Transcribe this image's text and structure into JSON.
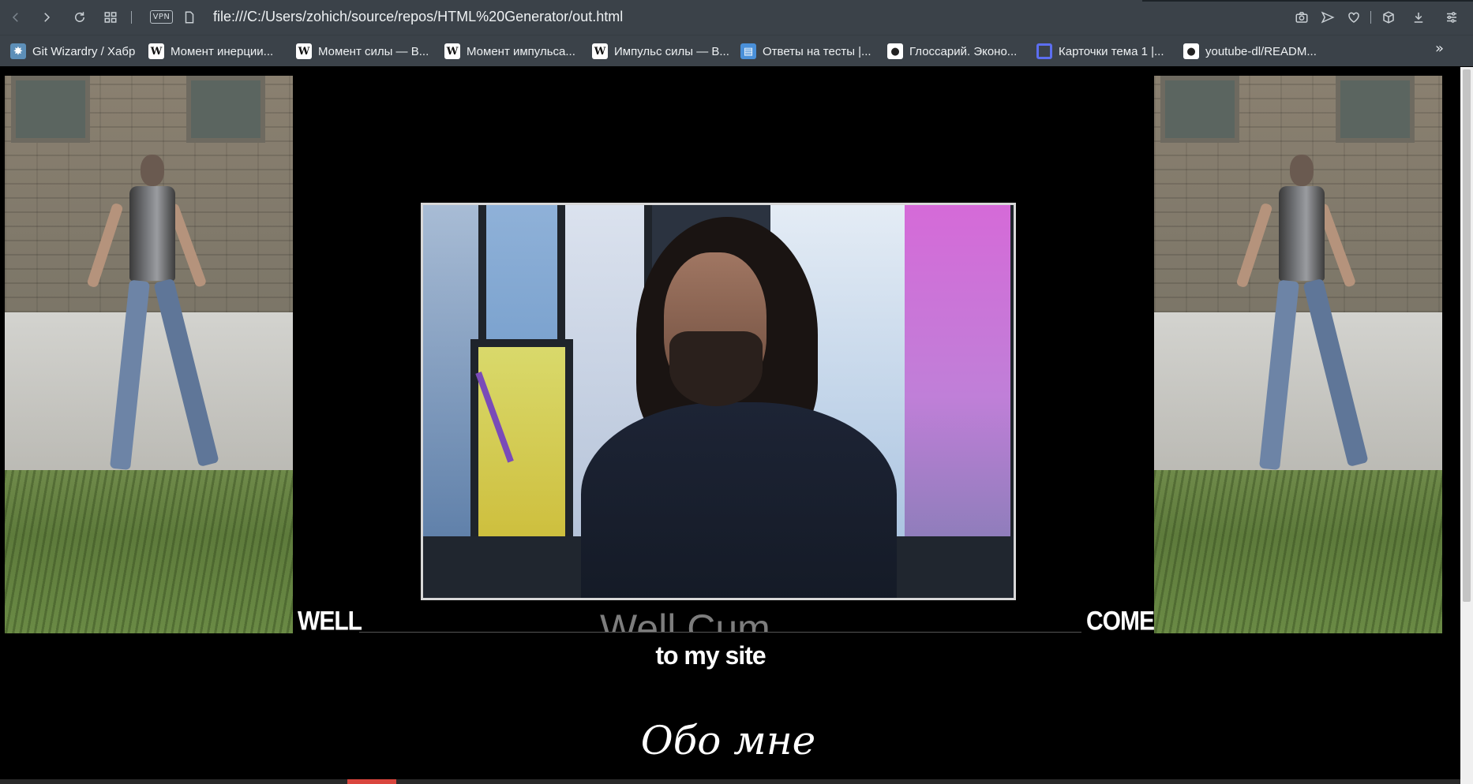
{
  "browser": {
    "url": "file:///C:/Users/zohich/source/repos/HTML%20Generator/out.html",
    "vpn_label": "VPN",
    "bookmarks": [
      {
        "label": "Git Wizardry / Хабр",
        "icon": "habr-icon"
      },
      {
        "label": "Момент инерции...",
        "icon": "wikipedia-icon"
      },
      {
        "label": "Момент силы — В...",
        "icon": "wikipedia-icon"
      },
      {
        "label": "Момент импульса...",
        "icon": "wikipedia-icon"
      },
      {
        "label": "Импульс силы — В...",
        "icon": "wikipedia-icon"
      },
      {
        "label": "Ответы на тесты |...",
        "icon": "document-icon"
      },
      {
        "label": "Глоссарий. Эконо...",
        "icon": "github-icon"
      },
      {
        "label": "Карточки тема 1 |...",
        "icon": "quizlet-icon"
      },
      {
        "label": "youtube-dl/READM...",
        "icon": "github-icon"
      }
    ],
    "more_bookmarks": "»"
  },
  "page": {
    "caption_partial": "Well Cum",
    "word_left": "WELL",
    "word_right": "COME",
    "subtitle": "to my site",
    "about_heading": "Обо мне"
  }
}
